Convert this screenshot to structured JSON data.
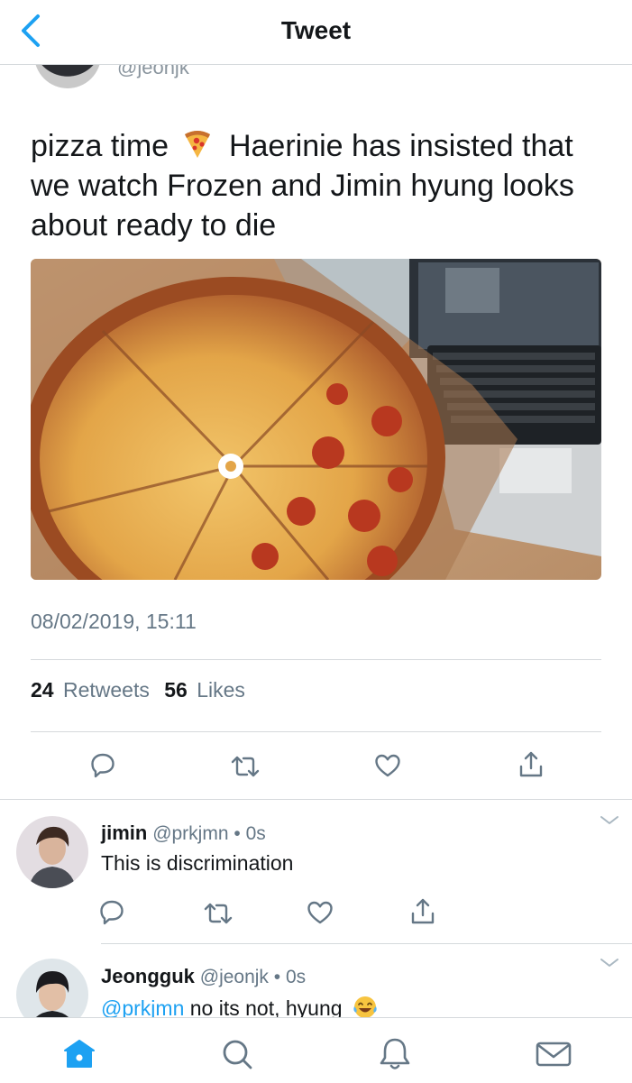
{
  "header": {
    "title": "Tweet"
  },
  "tweet": {
    "author_handle": "@jeonjk",
    "text_part1": "pizza time",
    "text_part2": "Haerinie has insisted that we watch Frozen and Jimin hyung looks about ready to die",
    "emoji": "pizza-icon",
    "timestamp": "08/02/2019, 15:11",
    "retweets_count": "24",
    "retweets_label": "Retweets",
    "likes_count": "56",
    "likes_label": "Likes",
    "actions": [
      "reply-icon",
      "retweet-icon",
      "like-icon",
      "share-icon"
    ]
  },
  "replies": [
    {
      "name": "jimin",
      "handle": "@prkjmn",
      "dot": "•",
      "time": "0s",
      "text": "This is discrimination"
    },
    {
      "name": "Jeongguk",
      "handle": "@jeonjk",
      "dot": "•",
      "time": "0s",
      "mention": "@prkjmn",
      "text": " no its not, hyung",
      "emoji": "laughing-tears-icon"
    }
  ],
  "tabs": [
    "home-icon",
    "search-icon",
    "notifications-icon",
    "messages-icon"
  ],
  "colors": {
    "accent": "#1da1f2",
    "secondary_text": "#657786",
    "divider": "#d5d9dc"
  }
}
